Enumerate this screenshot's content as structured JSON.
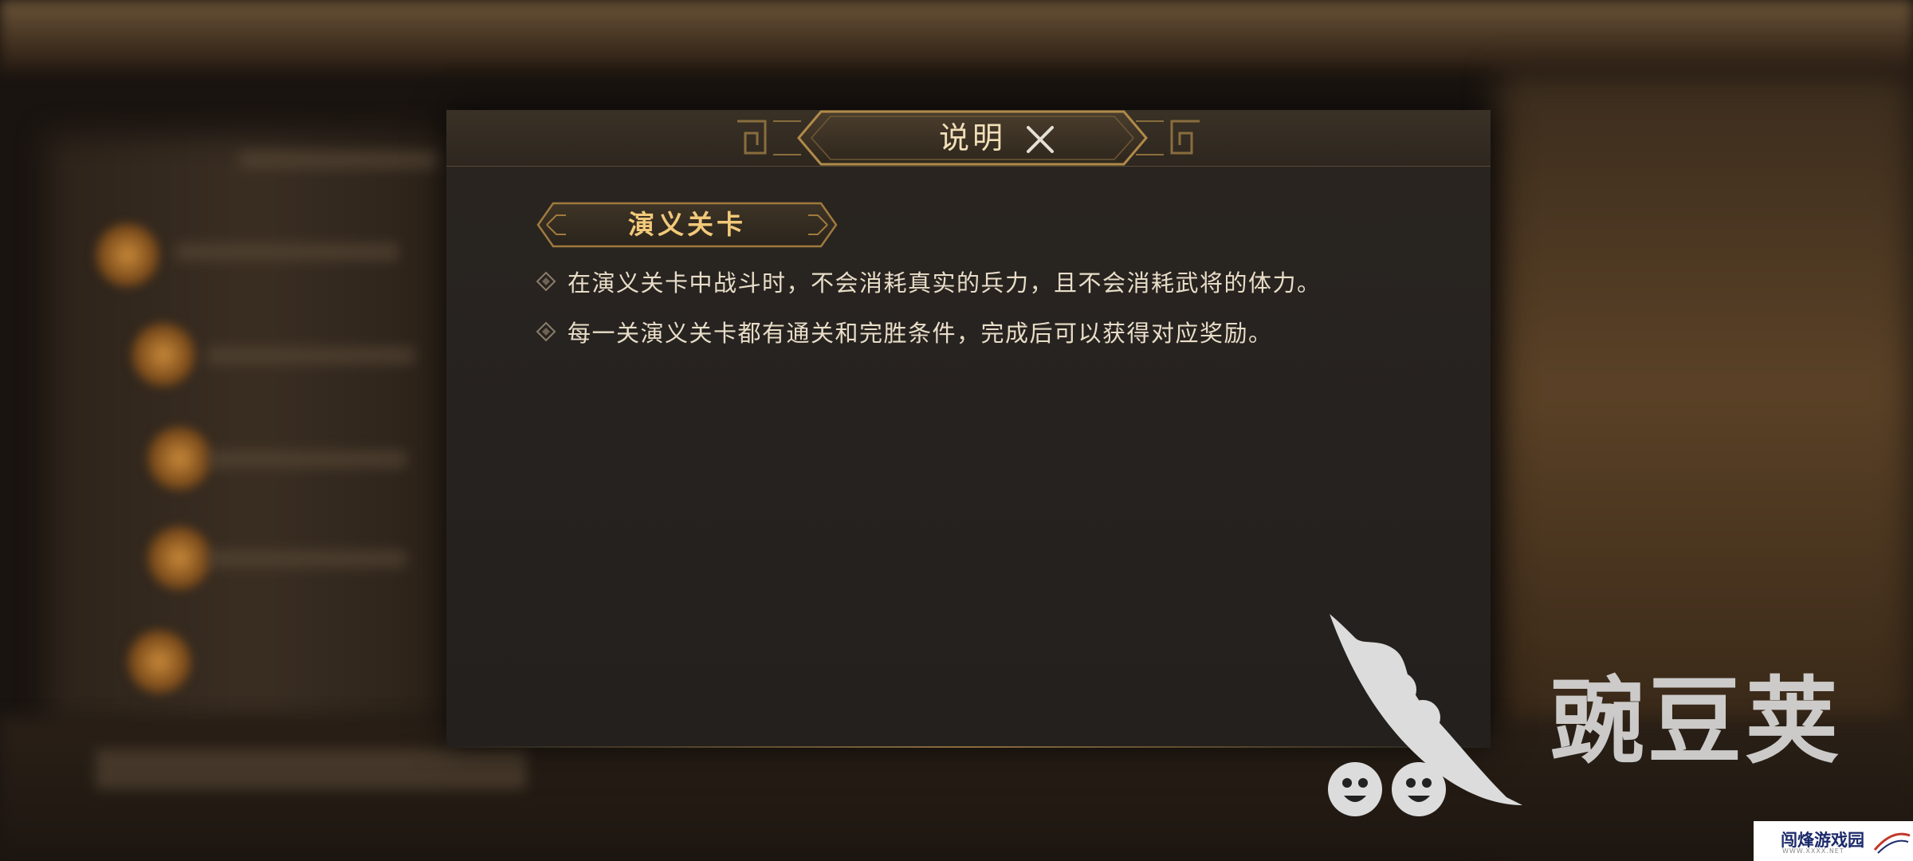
{
  "dialog": {
    "title": "说明",
    "close_icon": "close-icon",
    "section_title": "演义关卡",
    "lines": [
      "在演义关卡中战斗时，不会消耗真实的兵力，且不会消耗武将的体力。",
      "每一关演义关卡都有通关和完胜条件，完成后可以获得对应奖励。"
    ]
  },
  "watermark": {
    "brand_text": "豌豆荚",
    "brand_icon": "wandoujia-logo-icon",
    "site_badge_text": "闯烽游戏园",
    "site_badge_sub": "WWW.XXXX.NET"
  },
  "colors": {
    "title": "#f1dfb8",
    "section_title": "#f2c97a",
    "body_text": "#e8ddc8",
    "gold_border": "#a07a3e"
  }
}
